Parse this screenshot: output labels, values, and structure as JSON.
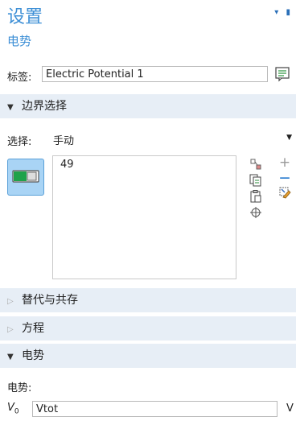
{
  "header": {
    "title": "设置",
    "subtitle": "电势",
    "pin": "▾ ▮"
  },
  "tag": {
    "label": "标签:",
    "value": "Electric Potential 1"
  },
  "boundary_section": {
    "label": "边界选择"
  },
  "selection": {
    "label": "选择:",
    "value": "手动"
  },
  "selection_list": {
    "items": [
      "49"
    ]
  },
  "sections": {
    "override": "替代与共存",
    "equation": "方程",
    "potential": "电势"
  },
  "potential": {
    "label": "电势:",
    "symbol": "V",
    "subscript": "0",
    "value": "Vtot",
    "unit": "V"
  },
  "icons": {
    "collapsed_arrow": "▷",
    "expanded_arrow": "▼",
    "dropdown": "▼",
    "plus": "+",
    "minus": "—"
  }
}
